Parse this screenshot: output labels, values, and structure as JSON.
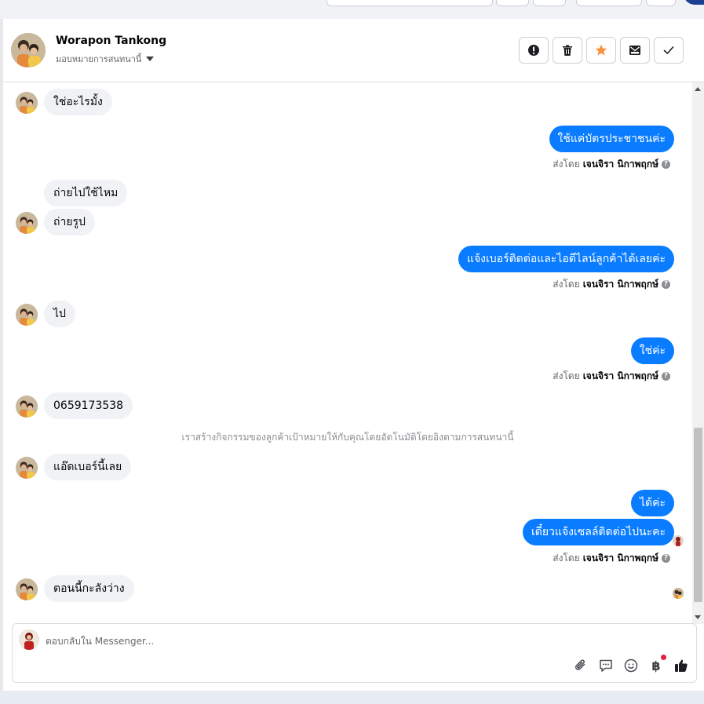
{
  "contact": {
    "name": "Worapon Tankong",
    "assign_label": "มอบหมายการสนทนานี้"
  },
  "header_actions": [
    {
      "name": "spam",
      "icon": "exclamation-circle-icon"
    },
    {
      "name": "delete",
      "icon": "trash-icon"
    },
    {
      "name": "star",
      "icon": "star-icon",
      "color": "#f7923a"
    },
    {
      "name": "mark-unread",
      "icon": "envelope-icon"
    },
    {
      "name": "done",
      "icon": "checkmark-icon"
    }
  ],
  "sent_by": {
    "prefix": "ส่งโดย",
    "agent": "เจนจิรา นิกาพฤกษ์"
  },
  "messages": {
    "m1": "ใช่อะไรมั้ง",
    "m2": "ใช้แค่บัตรประชาชนค่ะ",
    "m3": "ถ่ายไปใช้ไหม",
    "m4": "ถ่ายรูป",
    "m5": "แจ้งเบอร์ติดต่อและไอดีไลน์ลูกค้าได้เลยค่ะ",
    "m6": "ไป",
    "m7": "ใช่ค่ะ",
    "m8": "0659173538",
    "m9": "แอ๊ดเบอร์นี้เลย",
    "m10": "ได้ค่ะ",
    "m11": "เดี๋ยวแจ้งเซลล์ติดต่อไปนะคะ",
    "m12": "ตอนนี้กะลังว่าง"
  },
  "system_message": "เราสร้างกิจกรรมของลูกค้าเป้าหมายให้กับคุณโดยอัตโนมัติโดยอิงตามการสนทนานี้",
  "composer": {
    "placeholder": "ตอบกลับใน Messenger..."
  },
  "colors": {
    "outgoing_bubble": "#0a7cff",
    "incoming_bubble": "#f0f2f5",
    "star": "#f7923a"
  }
}
